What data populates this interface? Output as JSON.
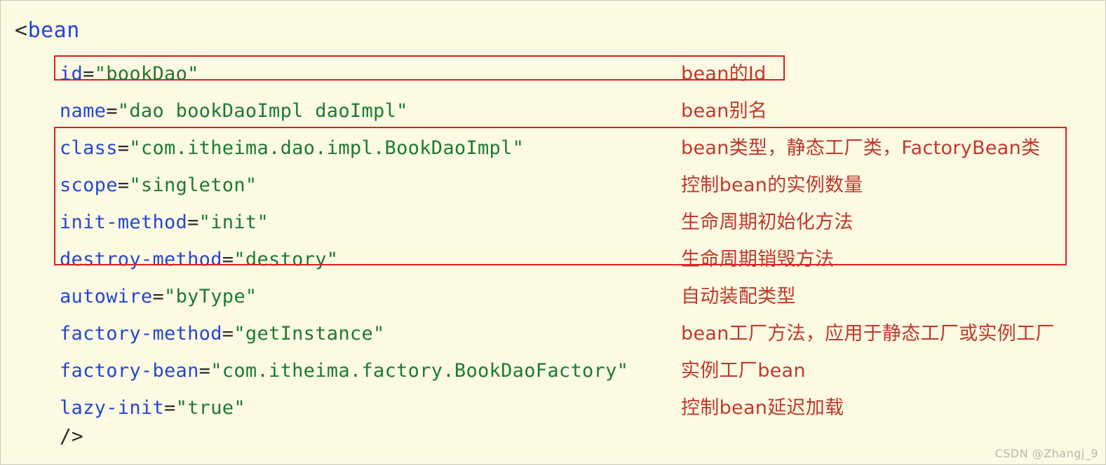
{
  "document": {
    "background_color": "#fdfae4",
    "border_color": "#c9c9bd",
    "root_tag_open": "<",
    "root_tag_name": "bean",
    "close_tag": "/>"
  },
  "colors": {
    "attribute_name": "#2546cf",
    "attribute_value": "#1d7a33",
    "punctuation": "#2b2b2b",
    "annotation": "#c0392b",
    "highlight_border": "#e02020",
    "watermark": "#b9b9b0"
  },
  "attributes": [
    {
      "name": "id",
      "eq": "=",
      "value": "\"bookDao\"",
      "annotation": "bean的Id",
      "highlighted": true
    },
    {
      "name": "name",
      "eq": "=",
      "value": "\"dao bookDaoImpl daoImpl\"",
      "annotation": "bean别名",
      "highlighted": false
    },
    {
      "name": "class",
      "eq": "=",
      "value": "\"com.itheima.dao.impl.BookDaoImpl\"",
      "annotation": "bean类型，静态工厂类，FactoryBean类",
      "highlighted": true
    },
    {
      "name": "scope",
      "eq": "=",
      "value": "\"singleton\"",
      "annotation": "控制bean的实例数量",
      "highlighted": true
    },
    {
      "name": "init-method",
      "eq": "=",
      "value": "\"init\"",
      "annotation": "生命周期初始化方法",
      "highlighted": true
    },
    {
      "name": "destroy-method",
      "eq": "=",
      "value": "\"destory\"",
      "annotation": "生命周期销毁方法",
      "highlighted": true
    },
    {
      "name": "autowire",
      "eq": "=",
      "value": "\"byType\"",
      "annotation": "自动装配类型",
      "highlighted": false
    },
    {
      "name": "factory-method",
      "eq": "=",
      "value": "\"getInstance\"",
      "annotation": "bean工厂方法，应用于静态工厂或实例工厂",
      "highlighted": false
    },
    {
      "name": "factory-bean",
      "eq": "=",
      "value": "\"com.itheima.factory.BookDaoFactory\"",
      "annotation": "实例工厂bean",
      "highlighted": false
    },
    {
      "name": "lazy-init",
      "eq": "=",
      "value": "\"true\"",
      "annotation": "控制bean延迟加载",
      "highlighted": false
    }
  ],
  "watermark": {
    "text": "CSDN @Zhangj_9"
  }
}
